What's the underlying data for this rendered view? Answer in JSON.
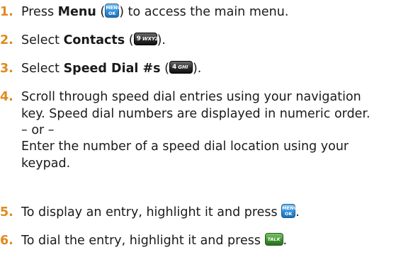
{
  "steps": [
    {
      "number": "1.",
      "pre": "Press ",
      "bold": "Menu",
      "mid": " (",
      "post": ") to access the main menu.",
      "icon": {
        "name": "menu-ok-key-icon",
        "top": "MENU",
        "bottom": "OK"
      }
    },
    {
      "number": "2.",
      "pre": "Select ",
      "bold": "Contacts",
      "mid": " (",
      "post": ").",
      "icon": {
        "name": "9-wxyz-key-icon",
        "digit": "9",
        "letters": "WXYZ"
      }
    },
    {
      "number": "3.",
      "pre": "Select ",
      "bold": "Speed Dial #s",
      "mid": " (",
      "post": ").",
      "icon": {
        "name": "4-ghi-key-icon",
        "digit": "4",
        "letters": "GHI"
      }
    },
    {
      "number": "4.",
      "lines": [
        "Scroll through speed dial entries using your navigation",
        "key. Speed dial numbers are displayed in numeric order.",
        "– or –",
        "Enter the number of a speed dial location using your",
        "keypad."
      ]
    },
    {
      "number": "5.",
      "pre": "To display an entry, highlight it and press ",
      "post": ".",
      "icon": {
        "name": "menu-ok-key-icon",
        "top": "MENU",
        "bottom": "OK"
      }
    },
    {
      "number": "6.",
      "pre": "To dial the entry, highlight it and press ",
      "post": ".",
      "icon": {
        "name": "talk-key-icon",
        "label": "TALK"
      }
    }
  ],
  "colors": {
    "step_number": "#e08a1e",
    "text": "#1a1a1a",
    "menu_key": "#2f8fd6",
    "dark_key": "#2a2a2a",
    "talk_key": "#3d8f2f"
  }
}
